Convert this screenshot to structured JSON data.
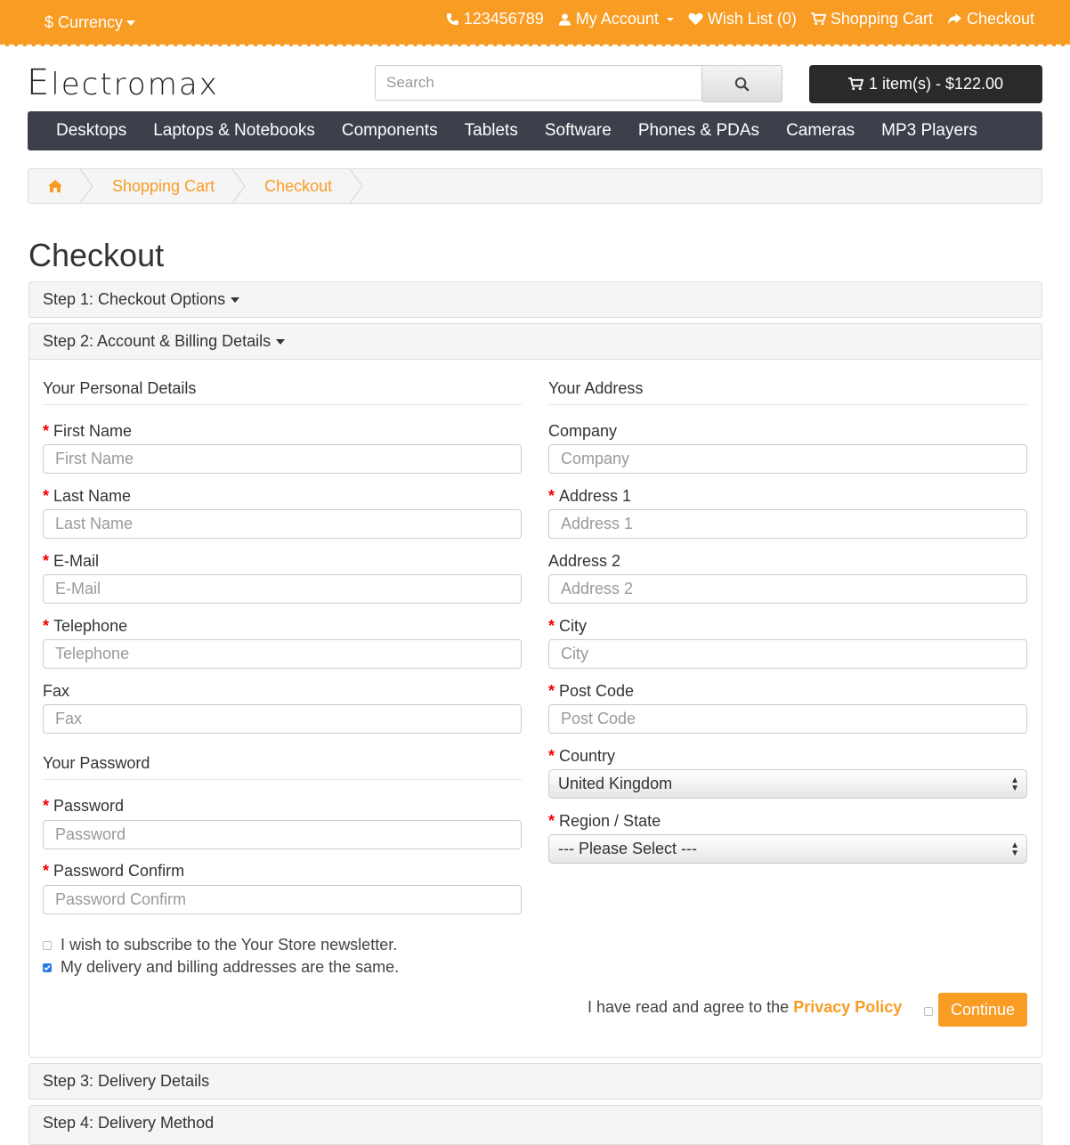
{
  "topbar": {
    "currency_label": "$ Currency",
    "phone": "123456789",
    "my_account": "My Account",
    "wish_list": "Wish List (0)",
    "shopping_cart": "Shopping Cart",
    "checkout": "Checkout",
    "color": "#f89c24"
  },
  "header": {
    "logo_first": "E",
    "logo_rest": "lectromax",
    "search_placeholder": "Search",
    "cart_summary": "1 item(s) - $122.00"
  },
  "menu": [
    "Desktops",
    "Laptops & Notebooks",
    "Components",
    "Tablets",
    "Software",
    "Phones & PDAs",
    "Cameras",
    "MP3 Players"
  ],
  "breadcrumb": [
    "Shopping Cart",
    "Checkout"
  ],
  "page_title": "Checkout",
  "steps": {
    "step1": "Step 1: Checkout Options",
    "step2": "Step 2: Account & Billing Details",
    "step3": "Step 3: Delivery Details",
    "step4": "Step 4: Delivery Method"
  },
  "personal": {
    "legend": "Your Personal Details",
    "first_name": {
      "label": "First Name",
      "placeholder": "First Name",
      "required": true
    },
    "last_name": {
      "label": "Last Name",
      "placeholder": "Last Name",
      "required": true
    },
    "email": {
      "label": "E-Mail",
      "placeholder": "E-Mail",
      "required": true
    },
    "telephone": {
      "label": "Telephone",
      "placeholder": "Telephone",
      "required": true
    },
    "fax": {
      "label": "Fax",
      "placeholder": "Fax",
      "required": false
    }
  },
  "password": {
    "legend": "Your Password",
    "password": {
      "label": "Password",
      "placeholder": "Password",
      "required": true
    },
    "confirm": {
      "label": "Password Confirm",
      "placeholder": "Password Confirm",
      "required": true
    }
  },
  "address": {
    "legend": "Your Address",
    "company": {
      "label": "Company",
      "placeholder": "Company",
      "required": false
    },
    "address1": {
      "label": "Address 1",
      "placeholder": "Address 1",
      "required": true
    },
    "address2": {
      "label": "Address 2",
      "placeholder": "Address 2",
      "required": false
    },
    "city": {
      "label": "City",
      "placeholder": "City",
      "required": true
    },
    "postcode": {
      "label": "Post Code",
      "placeholder": "Post Code",
      "required": true
    },
    "country": {
      "label": "Country",
      "value": "United Kingdom",
      "required": true
    },
    "region": {
      "label": "Region / State",
      "value": "--- Please Select ---",
      "required": true
    }
  },
  "options": {
    "newsletter": {
      "label": "I wish to subscribe to the Your Store newsletter.",
      "checked": false
    },
    "same_address": {
      "label": "My delivery and billing addresses are the same.",
      "checked": true
    }
  },
  "agree": {
    "text": "I have read and agree to the",
    "link": "Privacy Policy",
    "checked": false
  },
  "continue_label": "Continue",
  "required_mark": "*"
}
